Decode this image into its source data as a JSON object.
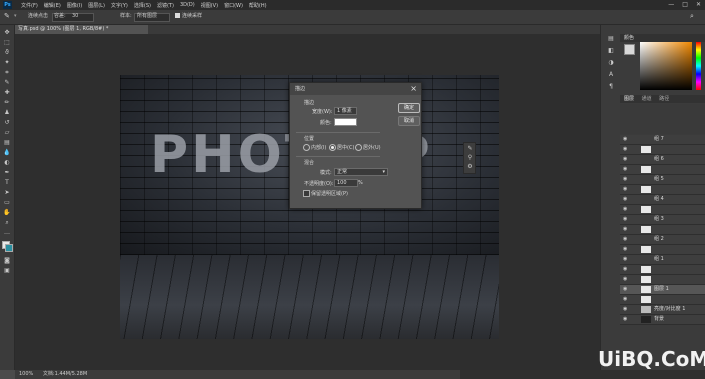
{
  "menubar": {
    "logo": "Ps",
    "items": [
      "文件(F)",
      "编辑(E)",
      "图像(I)",
      "图层(L)",
      "文字(Y)",
      "选择(S)",
      "滤镜(T)",
      "3D(D)",
      "视图(V)",
      "窗口(W)",
      "帮助(H)"
    ],
    "win_min": "—",
    "win_max": "□",
    "win_close": "✕"
  },
  "options": {
    "mode_label": "连续点击",
    "mode_value": "容差:",
    "tolerance_value": "30",
    "sample_label": "样本:",
    "sample_value": "所有图层",
    "checkbox_label": "连续采样"
  },
  "document": {
    "tab_title": "写真.psd @ 100% (图层 1, RGB/8#) *"
  },
  "canvas": {
    "wordmark": "PHOTO   P"
  },
  "dialog": {
    "title": "描边",
    "close": "×",
    "section_stroke": "描边",
    "width_label": "宽度(W):",
    "width_value": "1 像素",
    "color_label": "颜色:",
    "ok_label": "确定",
    "cancel_label": "取消",
    "section_position": "位置",
    "pos_inside": "内部(I)",
    "pos_center": "居中(C)",
    "pos_outside": "居外(U)",
    "section_blend": "混合",
    "mode_label": "模式:",
    "mode_value": "正常",
    "opacity_label": "不透明度(O):",
    "opacity_value": "100",
    "opacity_unit": "%",
    "preserve_label": "保留透明区域(P)"
  },
  "panels": {
    "color_tab": "颜色",
    "layers_tab": "图层",
    "channels_tab": "通道",
    "paths_tab": "路径",
    "layers": [
      {
        "name": "组 7"
      },
      {
        "name": "组 6"
      },
      {
        "name": "组 5"
      },
      {
        "name": "组 4"
      },
      {
        "name": "组 3"
      },
      {
        "name": "组 2"
      },
      {
        "name": "组 1"
      },
      {
        "name": "图层 1"
      },
      {
        "name": "亮度/对比度 1"
      },
      {
        "name": "背景"
      }
    ]
  },
  "status": {
    "zoom": "100%",
    "doc_info": "文档:1.44M/5.28M"
  },
  "watermark": "UiBQ.CoM"
}
